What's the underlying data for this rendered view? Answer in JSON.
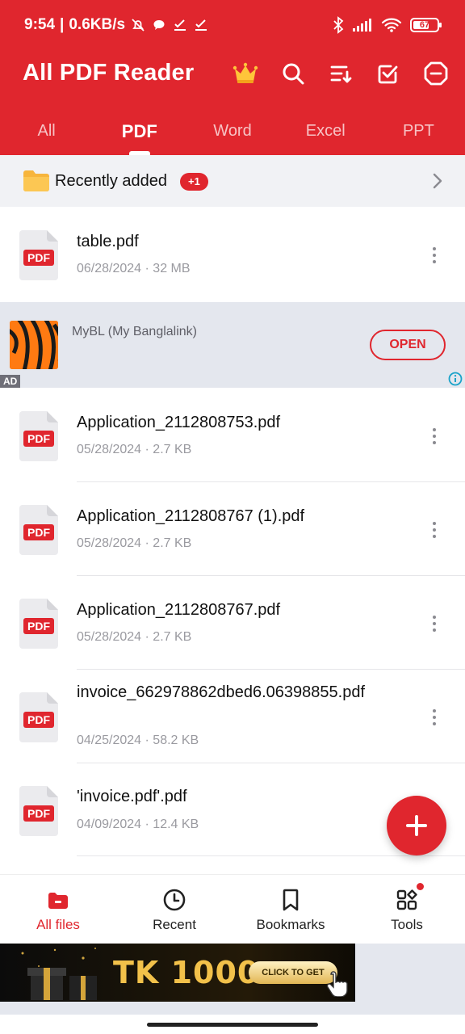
{
  "status_bar": {
    "time": "9:54",
    "network_speed": "0.6KB/s",
    "battery": "67",
    "battery_level": 0.67,
    "left_icons": [
      "muted-bell-icon",
      "chat-bubble-icon",
      "download-check-icon",
      "download-check-icon"
    ],
    "right_icons": [
      "bluetooth-icon",
      "signal-icon",
      "wifi-icon",
      "battery-icon"
    ]
  },
  "header": {
    "title": "All PDF Reader",
    "actions": [
      "crown-icon",
      "search-icon",
      "sort-icon",
      "select-check-icon",
      "remove-ads-icon"
    ]
  },
  "tabs": [
    {
      "label": "All",
      "active": false
    },
    {
      "label": "PDF",
      "active": true
    },
    {
      "label": "Word",
      "active": false
    },
    {
      "label": "Excel",
      "active": false
    },
    {
      "label": "PPT",
      "active": false
    }
  ],
  "recently_added": {
    "label": "Recently added",
    "badge": "+1"
  },
  "files": [
    {
      "name": "table.pdf",
      "meta": "06/28/2024 · 32 MB"
    },
    {
      "name": "Application_2112808753.pdf",
      "meta": "05/28/2024 · 2.7 KB"
    },
    {
      "name": "Application_2112808767 (1).pdf",
      "meta": "05/28/2024 · 2.7 KB"
    },
    {
      "name": "Application_2112808767.pdf",
      "meta": "05/28/2024 · 2.7 KB"
    },
    {
      "name": "invoice_662978862dbed6.06398855.pdf",
      "meta": "04/25/2024 · 58.2 KB"
    },
    {
      "name": "'invoice.pdf'.pdf",
      "meta": "04/09/2024 · 12.4 KB"
    }
  ],
  "file_icon_label": "PDF",
  "ad": {
    "title": "MyBL (My Banglalink)",
    "button": "OPEN",
    "label": "AD"
  },
  "bottom_nav": [
    {
      "label": "All files",
      "icon": "folder-icon",
      "active": true
    },
    {
      "label": "Recent",
      "icon": "clock-icon",
      "active": false
    },
    {
      "label": "Bookmarks",
      "icon": "bookmark-icon",
      "active": false
    },
    {
      "label": "Tools",
      "icon": "tools-grid-icon",
      "active": false
    }
  ],
  "banner": {
    "text": "TK 1000",
    "button": "CLICK TO GET"
  },
  "colors": {
    "brand_red": "#e0262e",
    "folder_yellow": "#f7b53c"
  }
}
